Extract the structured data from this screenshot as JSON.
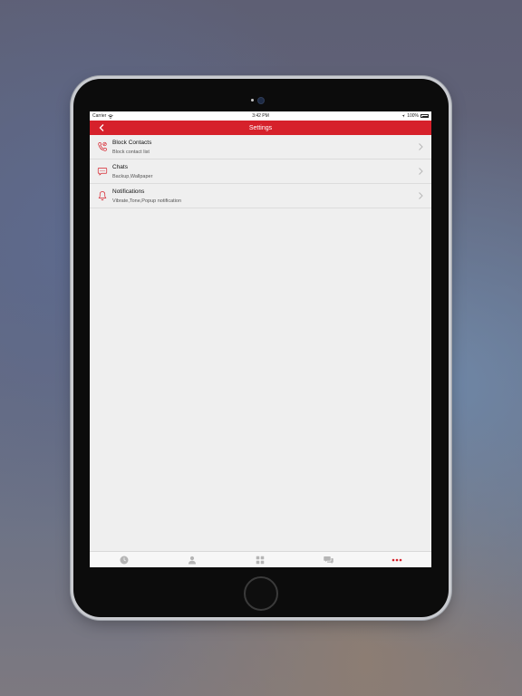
{
  "status_bar": {
    "carrier": "Carrier",
    "time": "3:42 PM",
    "battery": "100%"
  },
  "nav": {
    "title": "Settings"
  },
  "settings": [
    {
      "title": "Block Contacts",
      "subtitle": "Block contact list",
      "icon": "phone-block-icon"
    },
    {
      "title": "Chats",
      "subtitle": "Backup,Wallpaper",
      "icon": "chat-bubble-icon"
    },
    {
      "title": "Notifications",
      "subtitle": "Vibrate,Tone,Popup notification",
      "icon": "bell-icon"
    }
  ],
  "tabs": [
    {
      "icon": "clock-icon",
      "active": false
    },
    {
      "icon": "contacts-icon",
      "active": false
    },
    {
      "icon": "apps-grid-icon",
      "active": false
    },
    {
      "icon": "chats-icon",
      "active": false
    },
    {
      "icon": "more-icon",
      "active": true
    }
  ],
  "colors": {
    "accent": "#d6212b",
    "tab_inactive": "#b5b5b5",
    "tab_active": "#d6212b"
  }
}
